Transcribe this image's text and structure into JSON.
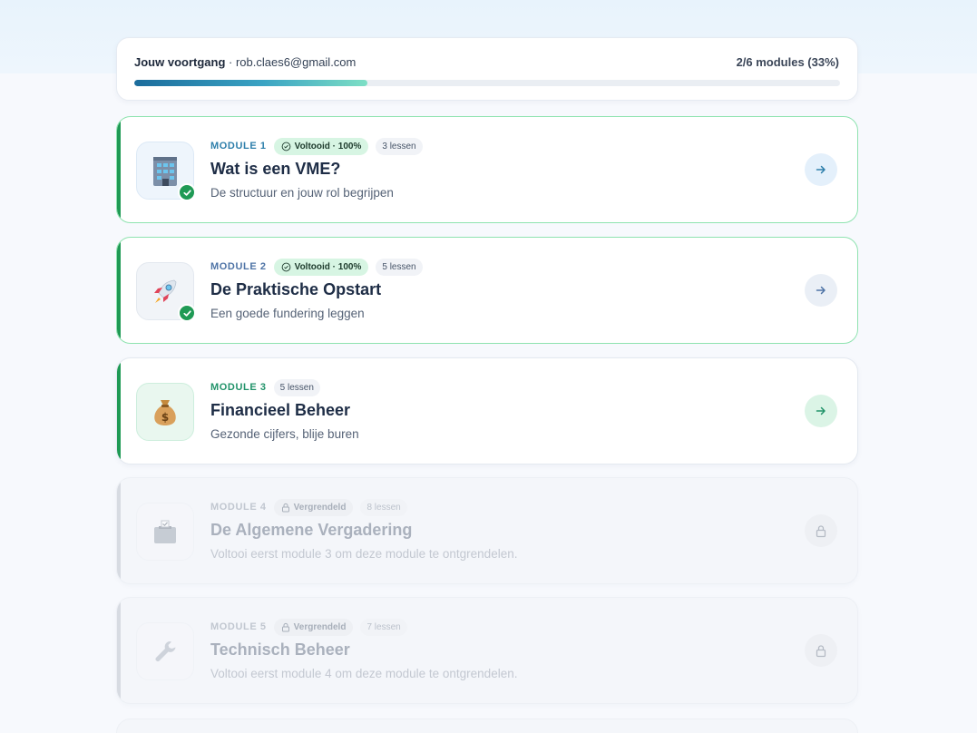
{
  "progress": {
    "label": "Jouw voortgang",
    "separator": " · ",
    "email": "rob.claes6@gmail.com",
    "count_text": "2/6 modules (33%)",
    "fraction": 0.33
  },
  "colors": {
    "accent_done": "#1f9a55",
    "accent_locked": "#d7dbe2",
    "progress_start": "#1b6c9c",
    "progress_end": "#7ddfc5"
  },
  "modules": [
    {
      "number_label": "MODULE 1",
      "status_label": "Voltooid · 100%",
      "lessons_label": "3 lessen",
      "title": "Wat is een VME?",
      "subtitle": "De structuur en jouw rol begrijpen",
      "icon": "building-icon",
      "state": "completed"
    },
    {
      "number_label": "MODULE 2",
      "status_label": "Voltooid · 100%",
      "lessons_label": "5 lessen",
      "title": "De Praktische Opstart",
      "subtitle": "Een goede fundering leggen",
      "icon": "rocket-icon",
      "state": "completed"
    },
    {
      "number_label": "MODULE 3",
      "lessons_label": "5 lessen",
      "title": "Financieel Beheer",
      "subtitle": "Gezonde cijfers, blije buren",
      "icon": "money-bag-icon",
      "state": "open"
    },
    {
      "number_label": "MODULE 4",
      "status_label": "Vergrendeld",
      "lessons_label": "8 lessen",
      "title": "De Algemene Vergadering",
      "subtitle": "Voltooi eerst module 3 om deze module te ontgrendelen.",
      "icon": "ballot-box-icon",
      "state": "locked"
    },
    {
      "number_label": "MODULE 5",
      "status_label": "Vergrendeld",
      "lessons_label": "7 lessen",
      "title": "Technisch Beheer",
      "subtitle": "Voltooi eerst module 4 om deze module te ontgrendelen.",
      "icon": "wrench-icon",
      "state": "locked"
    }
  ]
}
